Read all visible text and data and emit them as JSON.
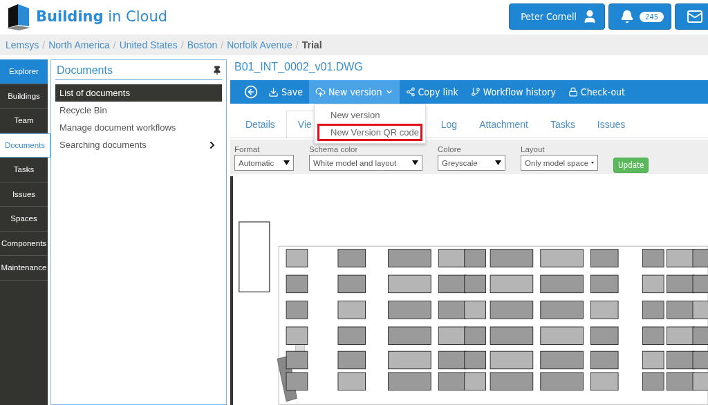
{
  "header": {
    "logo_bold": "Building",
    "logo_rest": " in Cloud",
    "user": "Peter Cornell",
    "notifications": "245"
  },
  "breadcrumb": [
    {
      "label": "Lemsys",
      "current": false
    },
    {
      "separator": "/",
      "label": "North America",
      "current": false
    },
    {
      "separator": "/",
      "label": "United States",
      "current": false
    },
    {
      "separator": "/",
      "label": "Boston",
      "current": false
    },
    {
      "separator": "/",
      "label": "Norfolk Avenue",
      "current": false
    },
    {
      "separator": "/",
      "label": "Trial",
      "current": true
    }
  ],
  "nav": [
    {
      "label": "Explorer",
      "kind": "home",
      "selected": false
    },
    {
      "label": "Buildings",
      "kind": "item",
      "selected": false
    },
    {
      "label": "Team",
      "kind": "item",
      "selected": false
    },
    {
      "label": "Documents",
      "kind": "item",
      "selected": true
    },
    {
      "label": "Tasks",
      "kind": "item",
      "selected": false
    },
    {
      "label": "Issues",
      "kind": "item",
      "selected": false
    },
    {
      "label": "Spaces",
      "kind": "item",
      "selected": false
    },
    {
      "label": "Components",
      "kind": "item",
      "selected": false
    },
    {
      "label": "Maintenance",
      "kind": "item",
      "selected": false
    }
  ],
  "panel": {
    "title": "Documents",
    "items": [
      {
        "label": "List of documents",
        "selected": true,
        "submenu": false
      },
      {
        "label": "Recycle Bin",
        "selected": false,
        "submenu": false
      },
      {
        "label": "Manage document workflows",
        "selected": false,
        "submenu": false
      },
      {
        "label": "Searching documents",
        "selected": false,
        "submenu": true
      }
    ]
  },
  "document": {
    "title": "B01_INT_0002_v01.DWG"
  },
  "toolbar": [
    {
      "label": "Save",
      "kind": "save",
      "open": false
    },
    {
      "label": "New version",
      "kind": "upload",
      "open": true
    },
    {
      "label": "Copy link",
      "kind": "share",
      "open": false
    },
    {
      "label": "Workflow history",
      "kind": "branch",
      "open": false
    },
    {
      "label": "Check-out",
      "kind": "lock",
      "open": false
    }
  ],
  "dropdown": [
    {
      "label": "New version",
      "highlighted": false
    },
    {
      "label": "New Version QR code",
      "highlighted": true
    }
  ],
  "tabs": [
    {
      "label": "Details",
      "selected": false
    },
    {
      "label": "Vie",
      "selected": true
    },
    {
      "label": "Log",
      "selected": false
    },
    {
      "label": "Attachment",
      "selected": false
    },
    {
      "label": "Tasks",
      "selected": false
    },
    {
      "label": "Issues",
      "selected": false
    }
  ],
  "filters": [
    {
      "label": "Format",
      "value": "Automatic"
    },
    {
      "label": "Schema color",
      "value": "White model and layout"
    },
    {
      "label": "Colore",
      "value": "Greyscale"
    },
    {
      "label": "Layout",
      "value": "Only model space"
    }
  ],
  "update_button": "Update"
}
